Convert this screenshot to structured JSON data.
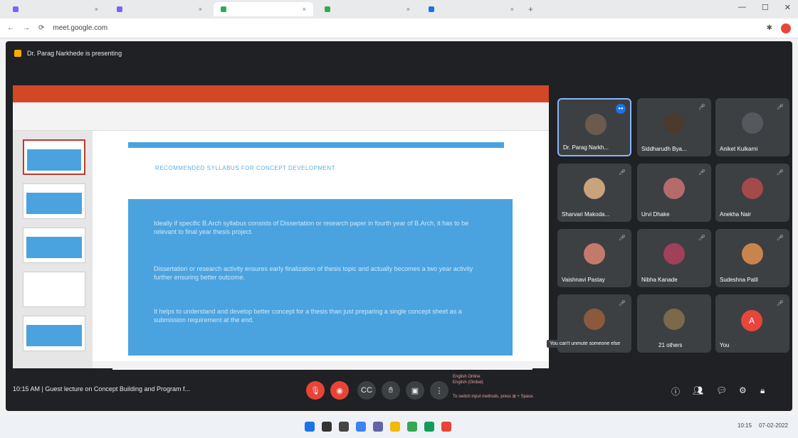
{
  "browser": {
    "tabs": [
      {
        "label": "",
        "color": "#7b61ff"
      },
      {
        "label": "",
        "color": "#7b61ff"
      },
      {
        "label": "",
        "color": "#34a853"
      },
      {
        "label": "",
        "color": "#34a853"
      },
      {
        "label": "",
        "color": "#1a73e8"
      }
    ],
    "url": "meet.google.com",
    "window_controls": [
      "—",
      "☐",
      "✕"
    ]
  },
  "meet": {
    "presenter_text": "Dr. Parag Narkhede is presenting",
    "slide": {
      "heading": "RECOMMENDED SYLLABUS FOR CONCEPT DEVELOPMENT",
      "bullets": [
        "Ideally if specific B.Arch syllabus consists of Dissertation or research paper in fourth year of B.Arch, it has to be relevant to final year thesis project.",
        "Dissertation or research activity ensures early finalization of thesis topic and actually becomes a two year activity further ensuring better outcome.",
        "It helps to understand and develop better concept for a thesis than just preparing a single concept sheet as a submission requirement at the end."
      ]
    },
    "participants": [
      {
        "name": "Dr. Parag Narkh...",
        "active": true
      },
      {
        "name": "Siddharudh Bya..."
      },
      {
        "name": "Aniket Kulkarni"
      },
      {
        "name": "Sharvari Makoda..."
      },
      {
        "name": "Urvi Dhake"
      },
      {
        "name": "Anekha Nair"
      },
      {
        "name": "Vaishnavi Pastay"
      },
      {
        "name": "Nibha Kanade"
      },
      {
        "name": "Sudeshna Patil"
      },
      {
        "name": ""
      },
      {
        "name": "21 others"
      },
      {
        "name": "You",
        "initial": "A"
      }
    ],
    "tooltip": "You can't unmute someone else",
    "bottom": {
      "time": "10:15 AM",
      "meeting_title": "Guest lecture on Concept Building and Program f...",
      "caption_lang_1": "English Online",
      "caption_lang_2": "English (Global)",
      "caption_note": "To switch input methods, press ⊞ + Space."
    }
  },
  "taskbar": {
    "clock": "10:15",
    "date": "07-02-2022"
  }
}
